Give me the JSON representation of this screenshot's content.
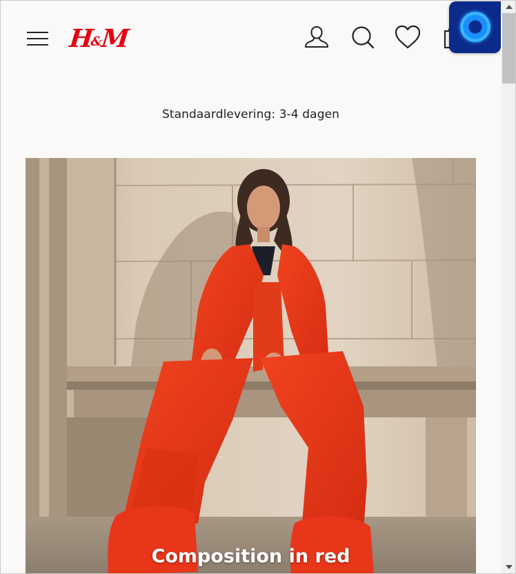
{
  "header": {
    "logo_text": "H&M",
    "brand_color": "#e50010",
    "icons": [
      "menu-icon",
      "account-icon",
      "search-icon",
      "heart-icon",
      "shopping-bag-icon"
    ]
  },
  "assistant": {
    "icon": "assistant-orb-icon",
    "color": "#0b2a8a"
  },
  "delivery_banner": {
    "text": "Standaardlevering: 3-4 dagen"
  },
  "hero": {
    "title": "Composition in red",
    "accent_color": "#e8361a"
  }
}
